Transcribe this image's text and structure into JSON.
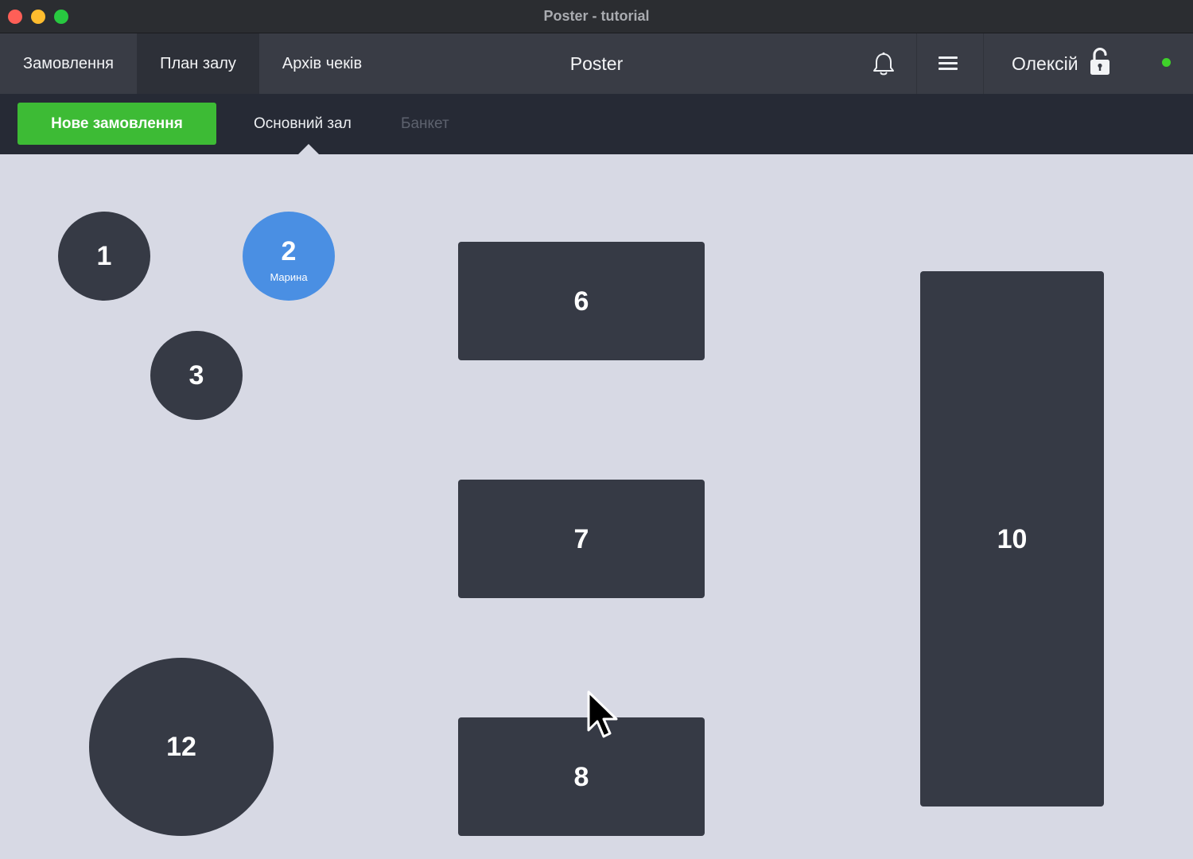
{
  "window": {
    "title": "Poster - tutorial"
  },
  "topnav": {
    "tabs": [
      {
        "label": "Замовлення",
        "active": false
      },
      {
        "label": "План залу",
        "active": true
      },
      {
        "label": "Архів чеків",
        "active": false
      }
    ],
    "app_title": "Poster",
    "icons": {
      "notifications": "bell-icon",
      "menu": "hamburger-icon",
      "lock": "unlock-icon"
    },
    "user_name": "Олексій",
    "status_color": "#3fd12a"
  },
  "subnav": {
    "new_order_label": "Нове замовлення",
    "halls": [
      {
        "label": "Основний зал",
        "active": true
      },
      {
        "label": "Банкет",
        "active": false
      }
    ]
  },
  "floor": {
    "tables": [
      {
        "number": "1",
        "shape": "round",
        "occupied": false
      },
      {
        "number": "2",
        "shape": "round",
        "occupied": true,
        "waiter": "Марина"
      },
      {
        "number": "3",
        "shape": "round",
        "occupied": false
      },
      {
        "number": "6",
        "shape": "rect",
        "occupied": false
      },
      {
        "number": "7",
        "shape": "rect",
        "occupied": false
      },
      {
        "number": "8",
        "shape": "rect",
        "occupied": false
      },
      {
        "number": "10",
        "shape": "rect",
        "occupied": false
      },
      {
        "number": "12",
        "shape": "round",
        "occupied": false
      }
    ]
  },
  "colors": {
    "accent_green": "#3dbb35",
    "occupied_blue": "#4a8fe3",
    "table_dark": "#363a45",
    "floor_bg": "#d7d9e4"
  }
}
